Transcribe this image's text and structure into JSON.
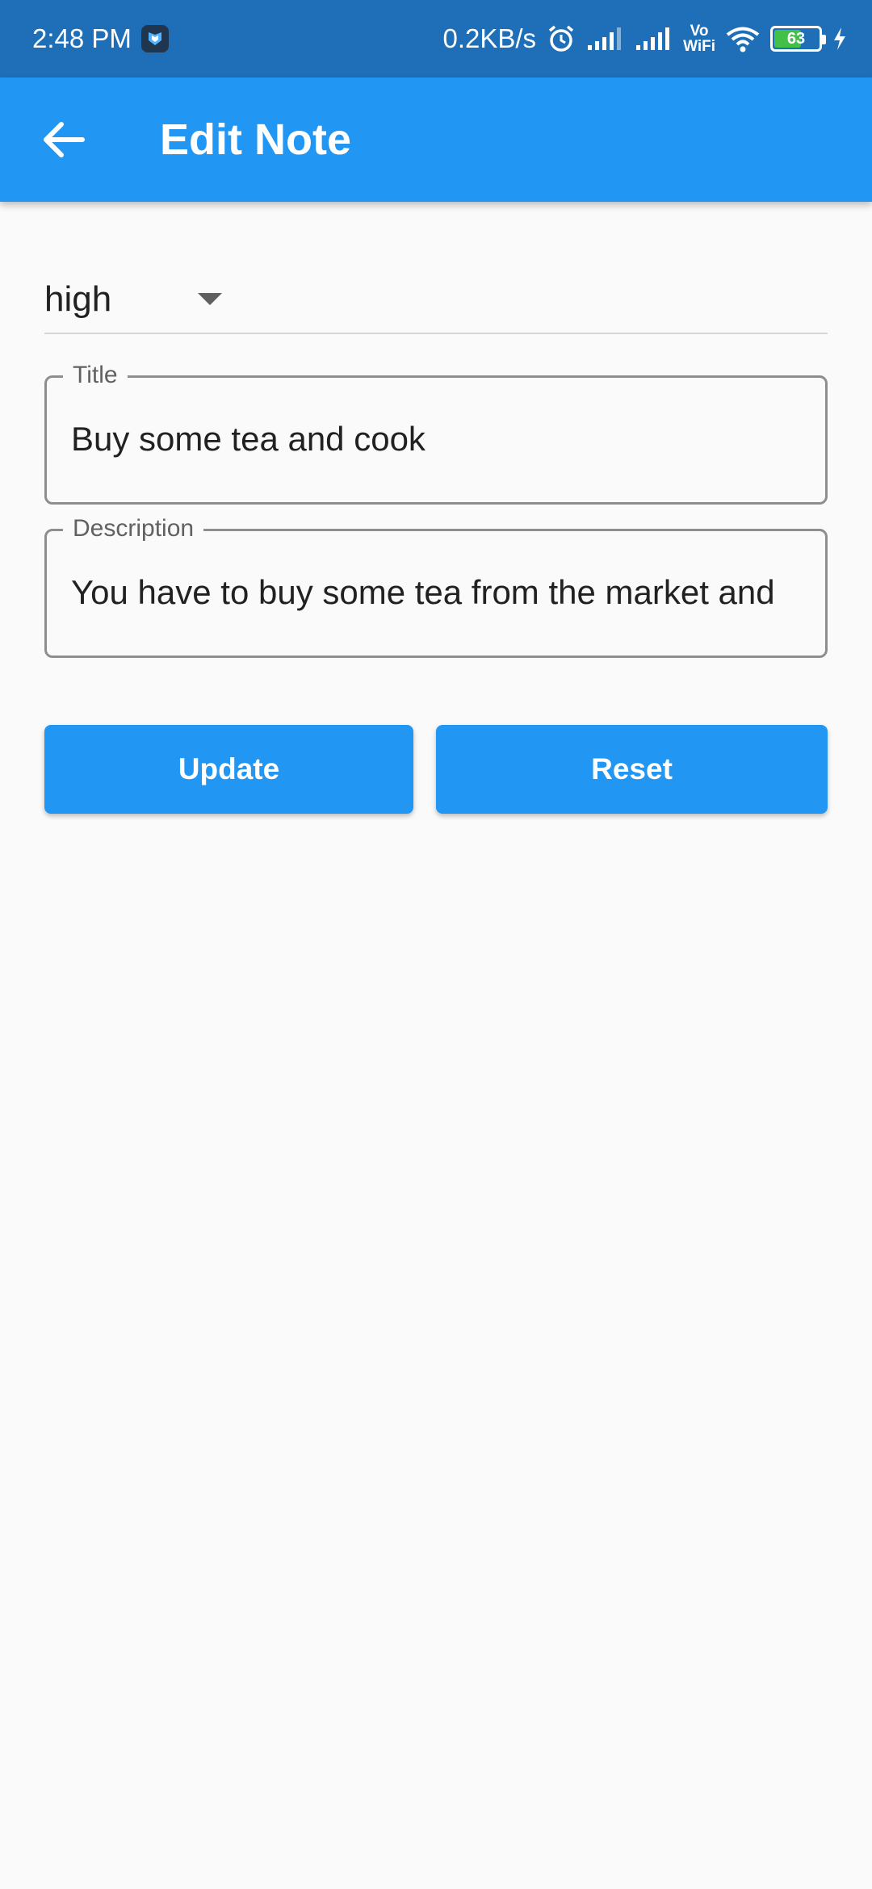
{
  "status_bar": {
    "time": "2:48 PM",
    "network_speed": "0.2KB/s",
    "vowifi_top": "Vo",
    "vowifi_bottom": "WiFi",
    "battery_level": "63",
    "battery_fraction": 0.63,
    "icons": [
      "app-shield-icon",
      "alarm-icon",
      "signal-icon",
      "signal-icon",
      "wifi-icon",
      "battery-icon",
      "charging-icon"
    ]
  },
  "app_bar": {
    "title": "Edit Note",
    "back_icon": "arrow-back-icon",
    "color": "#2196f3"
  },
  "form": {
    "priority": {
      "selected": "high",
      "icon": "dropdown-arrow-icon"
    },
    "title": {
      "label": "Title",
      "value": "Buy some tea and cook"
    },
    "description": {
      "label": "Description",
      "value": "You have to buy some tea from the market and"
    }
  },
  "actions": {
    "update_label": "Update",
    "reset_label": "Reset"
  }
}
